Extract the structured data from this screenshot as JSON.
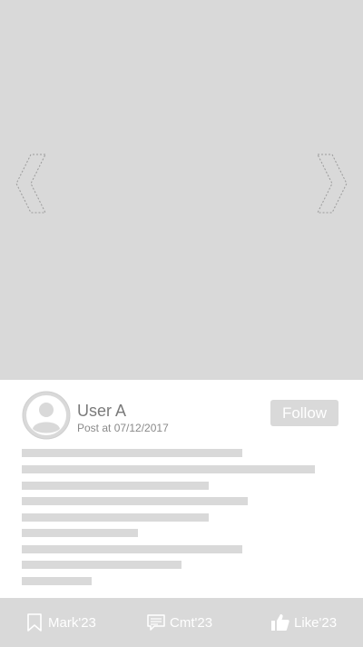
{
  "post": {
    "user_name": "User A",
    "post_date": "Post at 07/12/2017",
    "follow_label": "Follow"
  },
  "carousel": {
    "prev_icon": "chevron-left-icon",
    "next_icon": "chevron-right-icon"
  },
  "actions": {
    "mark_label": "Mark'23",
    "comment_label": "Cmt'23",
    "like_label": "Like'23"
  },
  "colors": {
    "placeholder_gray": "#d9d9d9",
    "text_gray": "#7a7a7a",
    "white": "#ffffff"
  }
}
